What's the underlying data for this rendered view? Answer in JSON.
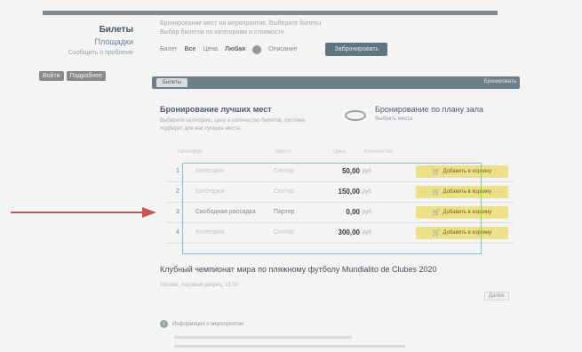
{
  "left": {
    "link_tickets": "Билеты",
    "link_2": "Площадки",
    "link_3": "Сообщить о проблеме",
    "buttons": [
      "Войти",
      "Подробнее"
    ]
  },
  "header": {
    "line1": "Бронирование мест на мероприятие. Выберите билеты",
    "line2": "Выбор билетов по категориям и стоимости",
    "filter_label1": "Билет",
    "filter_value1": "Все",
    "filter_label2": "Цена",
    "filter_value2": "Любая",
    "filter_label3": "Описание",
    "reserve_button": "Забронировать"
  },
  "tabbar": {
    "tab": "Билеты",
    "right_link": "Бронировать"
  },
  "book_best": {
    "title": "Бронирование лучших мест",
    "desc": "Выберите категорию, цену и количество билетов, система подберет для вас лучшие места."
  },
  "book_plan": {
    "title": "Бронирование по плану зала",
    "link": "Выбрать места"
  },
  "columns": [
    "Категория",
    "Место",
    "Цена",
    "Количество"
  ],
  "tickets": [
    {
      "idx": "1",
      "name": "Категория",
      "cat": "Сектор",
      "price": "50,00",
      "cur": "руб",
      "button": "Добавить в корзину"
    },
    {
      "idx": "2",
      "name": "Категория",
      "cat": "Сектор",
      "price": "150,00",
      "cur": "руб",
      "button": "Добавить в корзину"
    },
    {
      "idx": "3",
      "name": "Свободная рассадка",
      "cat": "Партер",
      "price": "0,00",
      "cur": "руб",
      "button": "Добавить в корзину"
    },
    {
      "idx": "4",
      "name": "Категория",
      "cat": "Сектор",
      "price": "300,00",
      "cur": "руб",
      "button": "Добавить в корзину"
    }
  ],
  "event": {
    "title": "Клубный чемпионат мира по пляжному футболу Mundialito de Clubes 2020",
    "subtitle": "Москва, ледовый дворец, 15:00",
    "more": "Далее"
  },
  "info": {
    "title": "Информация о мероприятии"
  },
  "colors": {
    "accent": "#6d7f8a",
    "cart": "#f5ea8a",
    "highlight_box": "#8fc3d6",
    "arrow": "#d05050"
  }
}
